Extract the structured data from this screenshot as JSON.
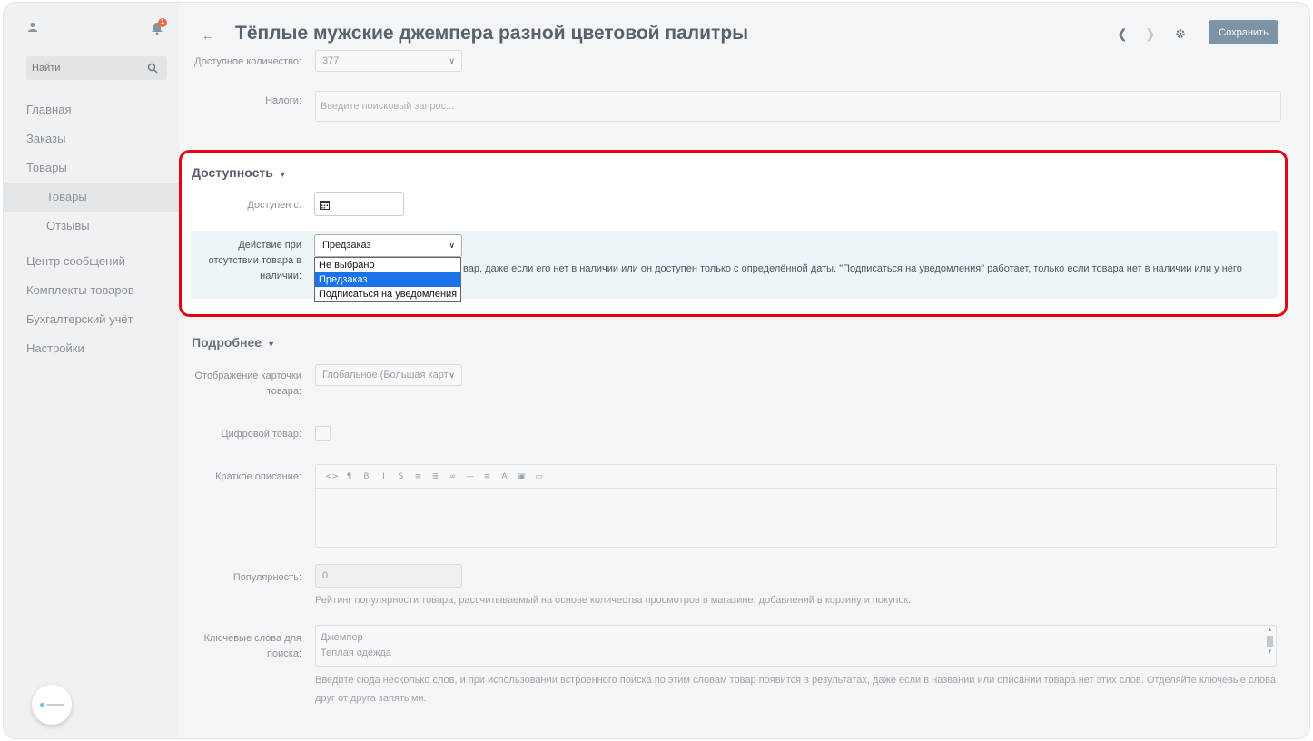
{
  "sidebar": {
    "notifications_count": "1",
    "search_placeholder": "Найти",
    "items": [
      {
        "label": "Главная"
      },
      {
        "label": "Заказы"
      },
      {
        "label": "Товары"
      },
      {
        "label": "Товары"
      },
      {
        "label": "Отзывы"
      },
      {
        "label": "Центр сообщений"
      },
      {
        "label": "Комплекты товаров"
      },
      {
        "label": "Бухгалтерский учёт"
      },
      {
        "label": "Настройки"
      }
    ]
  },
  "header": {
    "title": "Тёплые мужские джемпера разной цветовой палитры",
    "save_label": "Сохранить"
  },
  "fields": {
    "quantity_label": "Доступное количество:",
    "quantity_value": "377",
    "taxes_label": "Налоги:",
    "taxes_placeholder": "Введите поисковый запрос..."
  },
  "availability": {
    "section_title": "Доступность",
    "available_from_label": "Доступен с:",
    "action_label": "Действие при отсутствии товара в наличии:",
    "action_selected": "Предзаказ",
    "action_options": [
      "Не выбрано",
      "Предзаказ",
      "Подписаться на уведомления"
    ],
    "hint": "вар, даже если его нет в наличии или он доступен только с определённой даты. \"Подписаться на уведомления\" работает, только если товара нет в наличии или у него"
  },
  "details": {
    "section_title": "Подробнее",
    "display_label": "Отображение карточки товара:",
    "display_value": "Глобальное (Большая карт",
    "digital_label": "Цифровой товар:",
    "short_desc_label": "Краткое описание:",
    "toolbar_icons": [
      "<>",
      "¶",
      "B",
      "I",
      "S",
      "≡",
      "≣",
      "∞",
      "—",
      "≡",
      "A",
      "▣",
      "▭"
    ],
    "popularity_label": "Популярность:",
    "popularity_value": "0",
    "popularity_help": "Рейтинг популярности товара, рассчитываемый на основе количества просмотров в магазине, добавлений в корзину и покупок.",
    "keywords_label": "Ключевые слова для поиска:",
    "keywords_line1": "Джемпер",
    "keywords_line2": "Теплая одежда",
    "keywords_help": "Введите сюда несколько слов, и при использовании встроенного поиска по этим словам товар появится в результатах, даже если в названии или описании товара нет этих слов. Отделяйте ключевые слова друг от друга запятыми."
  },
  "colors": {
    "highlight": "#e20613",
    "save_button": "#7c94a6",
    "selected_option": "#1a73e8"
  }
}
